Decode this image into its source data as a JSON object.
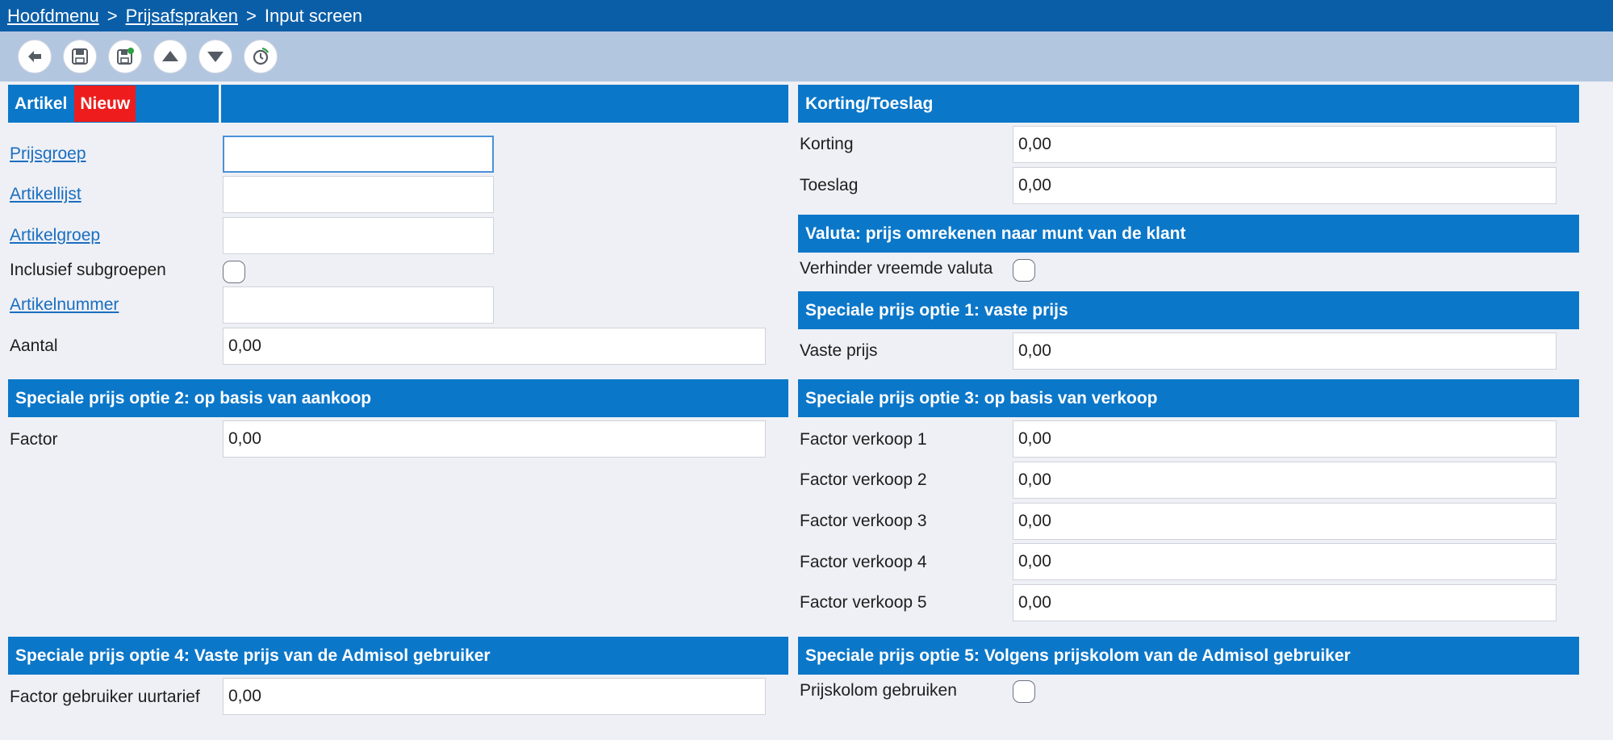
{
  "breadcrumb": {
    "home": "Hoofdmenu",
    "separator1": ">",
    "section": "Prijsafspraken",
    "separator2": ">",
    "current": "Input screen"
  },
  "toolbar": {
    "buttons": [
      "back-icon",
      "save-icon",
      "save-new-icon",
      "arrow-up-icon",
      "arrow-down-icon",
      "history-icon"
    ]
  },
  "artikel": {
    "title": "Artikel",
    "badge": "Nieuw",
    "fields": {
      "prijsgroep_label": "Prijsgroep",
      "prijsgroep_value": "",
      "artikellijst_label": "Artikellijst",
      "artikellijst_value": "",
      "artikelgroep_label": "Artikelgroep",
      "artikelgroep_value": "",
      "subgroepen_label": "Inclusief subgroepen",
      "artikelnummer_label": "Artikelnummer",
      "artikelnummer_value": "",
      "aantal_label": "Aantal",
      "aantal_value": "0,00"
    }
  },
  "korting": {
    "title": "Korting/Toeslag",
    "korting_label": "Korting",
    "korting_value": "0,00",
    "toeslag_label": "Toeslag",
    "toeslag_value": "0,00"
  },
  "valuta": {
    "title": "Valuta: prijs omrekenen naar munt van de klant",
    "verhinder_label": "Verhinder vreemde valuta"
  },
  "optie1": {
    "title": "Speciale prijs optie 1: vaste prijs",
    "vaste_prijs_label": "Vaste prijs",
    "vaste_prijs_value": "0,00"
  },
  "optie2": {
    "title": "Speciale prijs optie 2: op basis van aankoop",
    "factor_label": "Factor",
    "factor_value": "0,00"
  },
  "optie3": {
    "title": "Speciale prijs optie 3: op basis van verkoop",
    "rows": [
      {
        "label": "Factor verkoop 1",
        "value": "0,00"
      },
      {
        "label": "Factor verkoop 2",
        "value": "0,00"
      },
      {
        "label": "Factor verkoop 3",
        "value": "0,00"
      },
      {
        "label": "Factor verkoop 4",
        "value": "0,00"
      },
      {
        "label": "Factor verkoop 5",
        "value": "0,00"
      }
    ]
  },
  "optie4": {
    "title": "Speciale prijs optie 4: Vaste prijs van de Admisol gebruiker",
    "factor_label": "Factor gebruiker uurtarief",
    "factor_value": "0,00"
  },
  "optie5": {
    "title": "Speciale prijs optie 5: Volgens prijskolom van de Admisol gebruiker",
    "prijskolom_label": "Prijskolom gebruiken"
  },
  "colors": {
    "topbar": "#0a5ea8",
    "toolbar": "#b3c6e0",
    "section_header": "#0b77c9",
    "badge_new": "#ee1c1c",
    "link": "#1a6ec0",
    "background": "#eef0f5"
  }
}
